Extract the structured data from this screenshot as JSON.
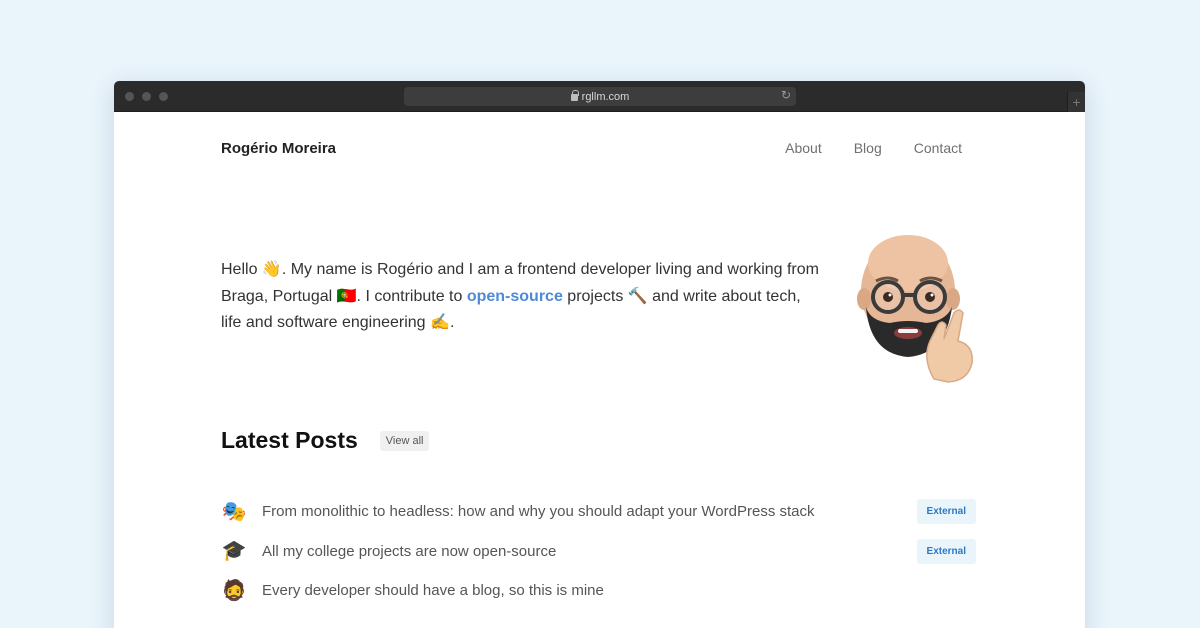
{
  "browser": {
    "url": "rgllm.com"
  },
  "header": {
    "site_name": "Rogério Moreira",
    "nav": [
      {
        "label": "About"
      },
      {
        "label": "Blog"
      },
      {
        "label": "Contact"
      }
    ]
  },
  "intro": {
    "part1": "Hello 👋. My name is Rogério and I am a frontend developer living and working from Braga, Portugal 🇵🇹. I contribute to ",
    "link_text": "open-source",
    "part2": " projects 🔨 and write about tech, life and software engineering ✍️."
  },
  "latest": {
    "heading": "Latest Posts",
    "view_all": "View all"
  },
  "posts": [
    {
      "icon": "🎭",
      "title": "From monolithic to headless: how and why you should adapt your WordPress stack",
      "badge": "External"
    },
    {
      "icon": "🎓",
      "title": "All my college projects are now open-source",
      "badge": "External"
    },
    {
      "icon": "🧔",
      "title": "Every developer should have a blog, so this is mine",
      "badge": ""
    }
  ],
  "colors": {
    "background": "#e9f4fb",
    "link": "#4f8ad9",
    "badge_text": "#2f78c4",
    "badge_bg": "#eaf4fb"
  }
}
